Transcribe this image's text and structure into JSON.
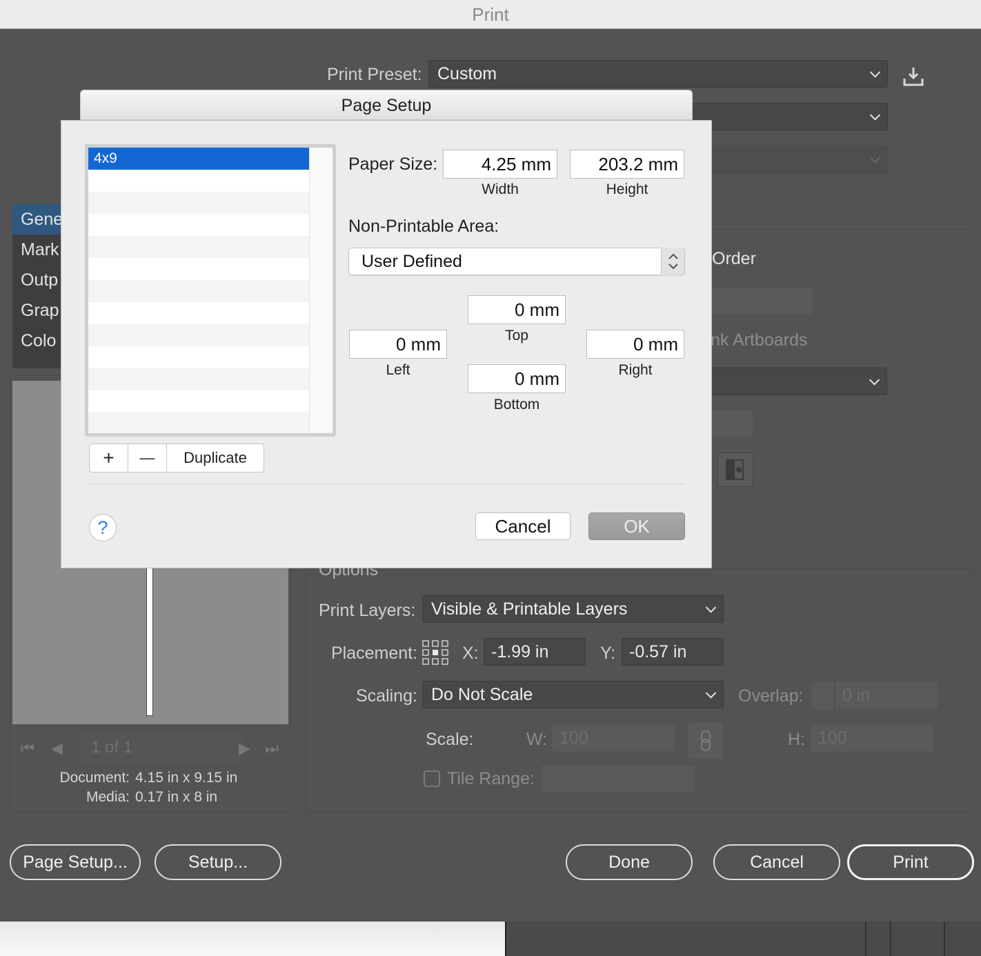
{
  "window": {
    "title": "Print"
  },
  "print": {
    "preset_label": "Print Preset:",
    "preset_value": "Custom",
    "sidebar": [
      {
        "label": "Gene"
      },
      {
        "label": "Mark"
      },
      {
        "label": "Outp"
      },
      {
        "label": "Grap"
      },
      {
        "label": "Colo"
      }
    ],
    "partial_order": "Order",
    "partial_artboards": "nk Artboards",
    "options_heading": "Options",
    "print_layers_label": "Print Layers:",
    "print_layers_value": "Visible & Printable Layers",
    "placement_label": "Placement:",
    "x_label": "X:",
    "x_value": "-1.99 in",
    "y_label": "Y:",
    "y_value": "-0.57 in",
    "scaling_label": "Scaling:",
    "scaling_value": "Do Not Scale",
    "overlap_label": "Overlap:",
    "overlap_value": "0 in",
    "scale_label": "Scale:",
    "w_label": "W:",
    "w_value": "100",
    "h_label": "H:",
    "h_value": "100",
    "tile_range_label": "Tile Range:",
    "pager": "1 of 1",
    "document_label": "Document:",
    "document_value": "4.15 in x 9.15 in",
    "media_label": "Media:",
    "media_value": "0.17 in x 8 in",
    "buttons": {
      "page_setup": "Page Setup...",
      "setup": "Setup...",
      "done": "Done",
      "cancel": "Cancel",
      "print": "Print"
    }
  },
  "page_setup": {
    "title": "Page Setup",
    "sizes": [
      {
        "name": "4x9"
      }
    ],
    "add": "+",
    "remove": "—",
    "duplicate": "Duplicate",
    "paper_size_label": "Paper Size:",
    "width_value": "4.25 mm",
    "width_caption": "Width",
    "height_value": "203.2 mm",
    "height_caption": "Height",
    "non_printable_label": "Non-Printable Area:",
    "non_printable_value": "User Defined",
    "top_value": "0 mm",
    "top_caption": "Top",
    "left_value": "0 mm",
    "left_caption": "Left",
    "right_value": "0 mm",
    "right_caption": "Right",
    "bottom_value": "0 mm",
    "bottom_caption": "Bottom",
    "help": "?",
    "cancel": "Cancel",
    "ok": "OK"
  }
}
